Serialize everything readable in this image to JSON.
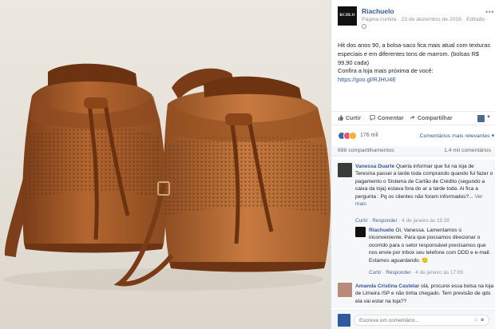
{
  "post": {
    "page_name": "Riachuelo",
    "logo_text": "RCHLO",
    "meta": "Página curtida · 23 de dezembro de 2016 · Editado ·",
    "text_lines": [
      "Hit dos anos 90, a bolsa-saco fica mais atual com texturas especiais e em diferentes tons de marrom. (bolsas R$ 99,90 cada)",
      "Confira a loja mais próxima de você:"
    ],
    "link": "https://goo.gl/RJHU4E"
  },
  "actions": {
    "like": "Curtir",
    "comment": "Comentar",
    "share": "Compartilhar"
  },
  "reactions": {
    "count": "176 mil",
    "sort_label": "Comentários mais relevantes ▾"
  },
  "stats": {
    "shares": "698 compartilhamentos",
    "comments": "1,4 mil comentários"
  },
  "comments": [
    {
      "author": "Vanessa Duarte",
      "text": "Queria informar que fui na loja de Teresina passei a tarde toda comprando quando fui fazer o pagamento o Sistema de Cartão de Crédito (segundo a caixa da loja) estava fora do ar a tarde toda. Ai fica a pergunta : Pq os clientes não foram informados?...",
      "see_more": "Ver mais",
      "like": "Curtir",
      "reply": "Responder",
      "time": "4 de janeiro às 15:39"
    },
    {
      "author": "Riachuelo",
      "text": "Oi, Vanessa. Lamentamos o inconveniente. Para que possamos direcionar o ocorrido para o setor responsável precisamos que nos envie por inbox seu telefone com DDD e e-mail. Estamos aguardando. 🙂",
      "like": "Curtir",
      "reply": "Responder",
      "time": "4 de janeiro às 17:09"
    },
    {
      "author": "Amanda Cristina Castelar",
      "text": "olá, procurei essa bolsa na loja de Limeira /SP e não tinha chegado. Tem previsão de qdo ela vai estar na loja??"
    }
  ],
  "composer": {
    "placeholder": "Escreva um comentário..."
  },
  "colors": {
    "link_blue": "#365899",
    "fb_blue": "#4267b2",
    "leather": "#b86a35"
  }
}
